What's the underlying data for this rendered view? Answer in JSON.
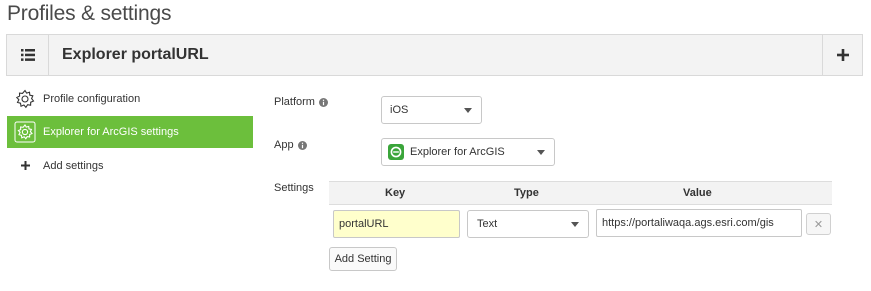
{
  "page": {
    "title": "Profiles & settings"
  },
  "header": {
    "title": "Explorer portalURL"
  },
  "sidebar": {
    "items": [
      {
        "label": "Profile configuration",
        "icon": "gear-outline-icon"
      },
      {
        "label": "Explorer for ArcGIS settings",
        "icon": "settings-gear-icon",
        "active": true
      },
      {
        "label": "Add settings",
        "icon": "plus-icon"
      }
    ]
  },
  "form": {
    "platform_label": "Platform",
    "platform_value": "iOS",
    "app_label": "App",
    "app_value": "Explorer for ArcGIS",
    "settings_label": "Settings"
  },
  "settings_table": {
    "headers": {
      "key": "Key",
      "type": "Type",
      "value": "Value"
    },
    "rows": [
      {
        "key": "portalURL",
        "type": "Text",
        "value": "https://portaliwaqa.ags.esri.com/gis"
      }
    ],
    "add_button": "Add Setting",
    "remove_icon": "close-icon"
  },
  "colors": {
    "active_green": "#6cbf3c",
    "key_highlight": "#ffffcc",
    "header_bg": "#f3f3f3"
  }
}
